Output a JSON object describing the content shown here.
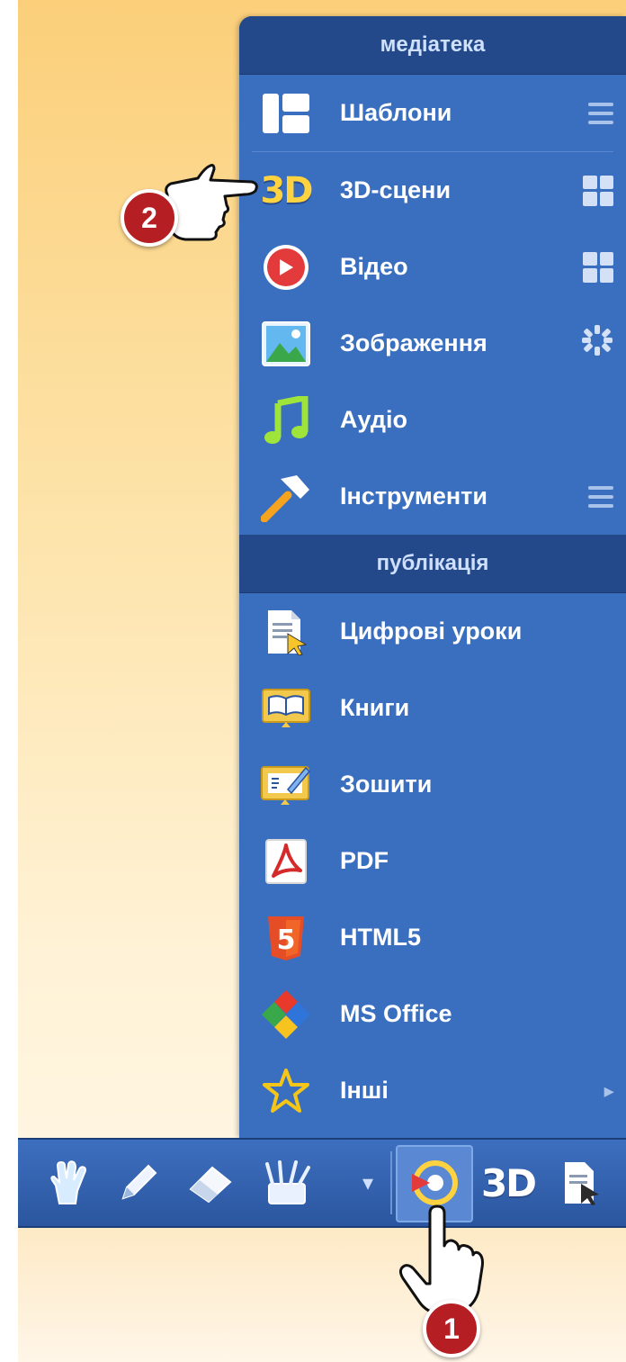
{
  "library": {
    "header": "медіатека",
    "items": [
      {
        "label": "Шаблони",
        "icon": "templates-icon",
        "right": "list-icon"
      },
      {
        "label": "3D-сцени",
        "icon": "3d-icon",
        "icon_text": "3D",
        "right": "grid-icon"
      },
      {
        "label": "Відео",
        "icon": "video-play-icon",
        "right": "grid-icon"
      },
      {
        "label": "Зображення",
        "icon": "image-icon",
        "right": "loading-icon"
      },
      {
        "label": "Аудіо",
        "icon": "music-note-icon",
        "right": ""
      },
      {
        "label": "Інструменти",
        "icon": "hammer-icon",
        "right": "list-icon"
      }
    ]
  },
  "publication": {
    "header": "публікація",
    "items": [
      {
        "label": "Цифрові уроки",
        "icon": "digital-lesson-icon"
      },
      {
        "label": "Книги",
        "icon": "book-icon"
      },
      {
        "label": "Зошити",
        "icon": "notebook-icon"
      },
      {
        "label": "PDF",
        "icon": "pdf-icon"
      },
      {
        "label": "HTML5",
        "icon": "html5-icon",
        "icon_text": "5"
      },
      {
        "label": "MS Office",
        "icon": "ms-office-icon"
      },
      {
        "label": "Інші",
        "icon": "star-icon",
        "right": "▸"
      }
    ]
  },
  "toolbar": {
    "items": [
      "pointer-hand-icon",
      "pencil-icon",
      "eraser-icon",
      "brushes-icon",
      "dropdown-arrow-icon",
      "media-library-icon",
      "3d-icon",
      "digital-lesson-icon"
    ],
    "dropdown": "▾",
    "threeD": "3D"
  },
  "annotations": {
    "step1": "1",
    "step2": "2"
  },
  "colors": {
    "panel": "#3a6fc0",
    "header": "#24498a",
    "badge": "#b51f24",
    "accent_yellow": "#ffd23f"
  }
}
